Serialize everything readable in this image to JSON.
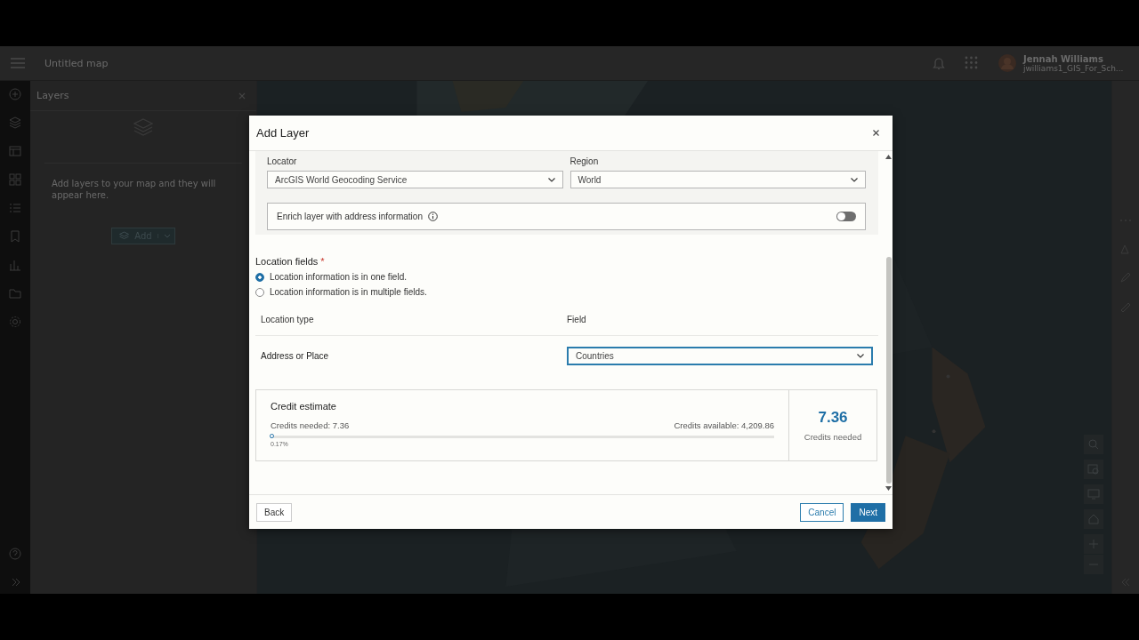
{
  "app_header": {
    "title": "Untitled map",
    "user": {
      "name": "Jennah Williams",
      "account": "jwilliams1_GIS_For_Sch..."
    }
  },
  "layers_panel": {
    "title": "Layers",
    "empty_message": "Add layers to your map and they will appear here.",
    "add_button": "Add"
  },
  "dialog": {
    "title": "Add Layer",
    "locator": {
      "label": "Locator",
      "value": "ArcGIS World Geocoding Service"
    },
    "region": {
      "label": "Region",
      "value": "World"
    },
    "enrich": {
      "label": "Enrich layer with address information",
      "on": false
    },
    "location_fields": {
      "label": "Location fields",
      "required_mark": "*",
      "options": [
        {
          "label": "Location information is in one field.",
          "selected": true
        },
        {
          "label": "Location information is in multiple fields.",
          "selected": false
        }
      ]
    },
    "mapping": {
      "columns": [
        "Location type",
        "Field"
      ],
      "rows": [
        {
          "location_type": "Address or Place",
          "field": "Countries",
          "focused": true
        }
      ]
    },
    "credit_estimate": {
      "title": "Credit estimate",
      "needed_label": "Credits needed: 7.36",
      "available_label": "Credits available: 4,209.86",
      "level": 0.0017,
      "percent": "0.17%",
      "big_value": "7.36",
      "big_caption": "Credits needed"
    },
    "buttons": [
      {
        "label": "Back",
        "kind": "secondary"
      },
      {
        "label": "Cancel",
        "kind": "outline"
      },
      {
        "label": "Next",
        "kind": "primary"
      }
    ]
  }
}
